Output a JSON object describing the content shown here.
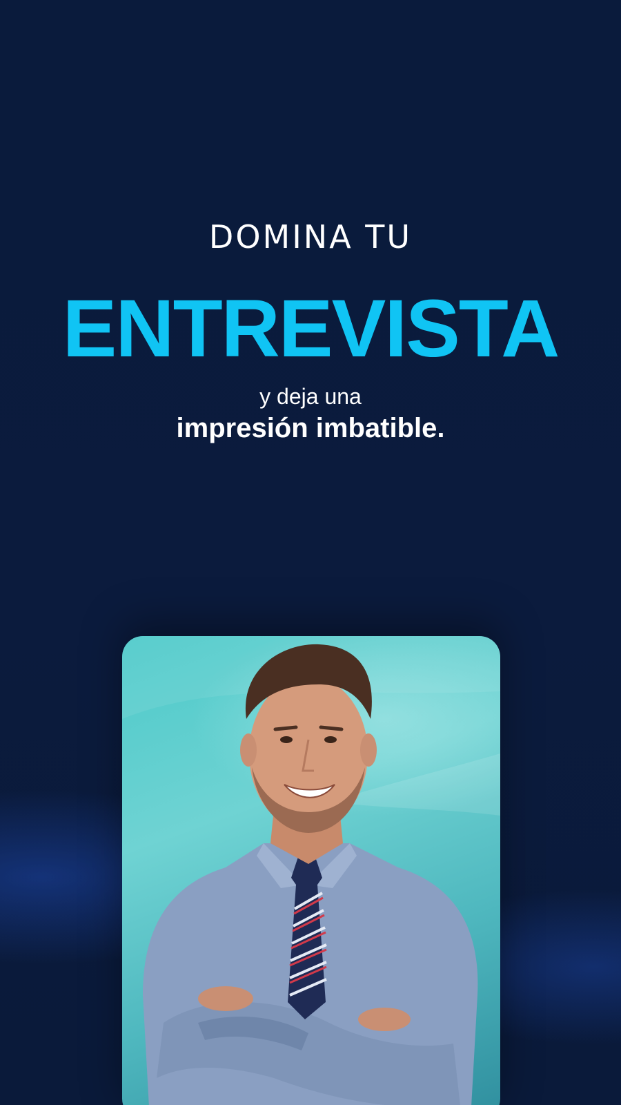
{
  "headline": {
    "eyebrow": "DOMINA TU",
    "main_word": "ENTREVISTA",
    "sub_line1": "y deja una",
    "sub_line2": "impresión imbatible."
  },
  "colors": {
    "background": "#0b1a3a",
    "accent": "#10c4f4",
    "card_teal": "#4cc9c9"
  },
  "photo": {
    "subject": "smiling man in blue shirt and striped tie with arms crossed"
  }
}
